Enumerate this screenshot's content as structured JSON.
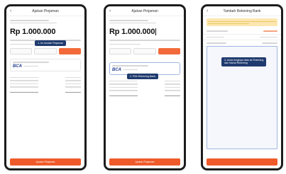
{
  "screens": [
    {
      "title": "Ajukan Pinjaman",
      "amount": "Rp 1.000.000",
      "tooltip": "1. Isi Jumlah Pinjaman",
      "bank": "BCA",
      "cta": "Ajukan Pinjaman"
    },
    {
      "title": "Ajukan Pinjaman",
      "amount": "Rp 1.000.000",
      "tooltip": "2. Pilih Rekening Bank",
      "bank": "BCA",
      "cta": "Ajukan Pinjaman"
    },
    {
      "title": "Tambah Rekening Bank",
      "tooltip_line1": "3. Anda lengkapi data Isi Rekening",
      "tooltip_line2": "dan Nama Rekening",
      "cta": ""
    }
  ],
  "colors": {
    "accent": "#ef5a2a",
    "tooltip": "#1f3a6e",
    "bank_blue": "#1b3a8c",
    "banner": "#fde7b0"
  },
  "icons": {
    "back": "back-arrow-icon"
  }
}
